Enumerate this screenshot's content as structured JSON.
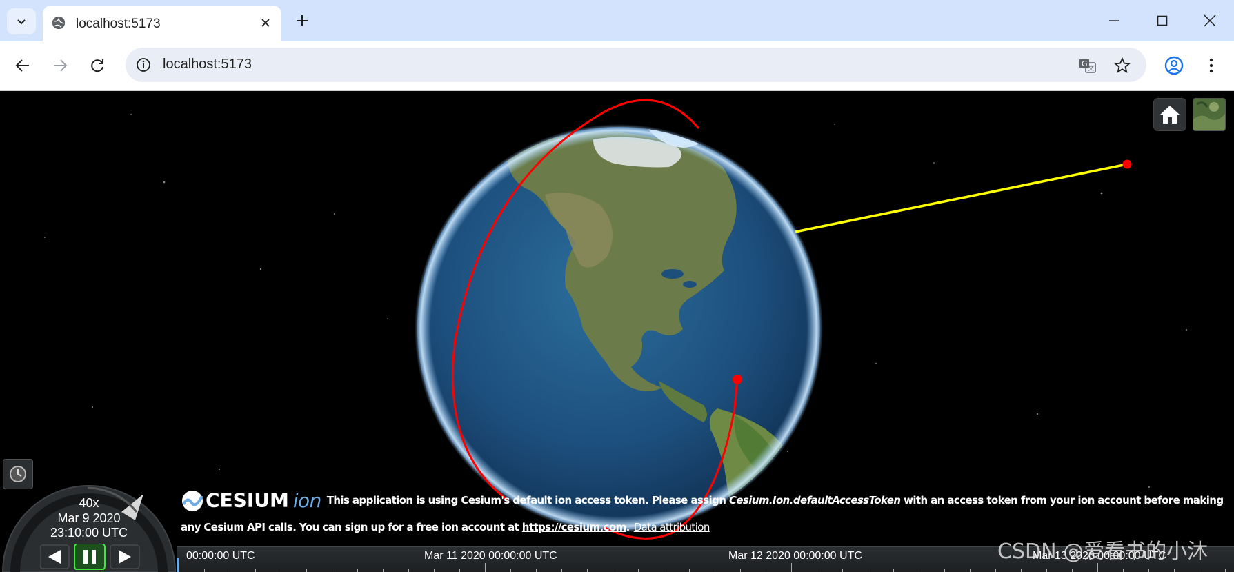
{
  "browser": {
    "tab_title": "localhost:5173",
    "url": "localhost:5173",
    "icons": [
      "tab-search-icon",
      "globe-icon",
      "close-icon",
      "plus-icon",
      "minimize-icon",
      "maximize-icon",
      "window-close-icon",
      "back-icon",
      "forward-icon",
      "reload-icon",
      "site-info-icon",
      "translate-icon",
      "bookmark-star-icon",
      "profile-icon",
      "menu-icon"
    ]
  },
  "viewer": {
    "credit": {
      "logo_text": "CESIUM",
      "logo_suffix": "ion",
      "text_1": "This application is using Cesium's default ion access token. Please assign ",
      "token_name": "Cesium.Ion.defaultAccessToken",
      "text_2": " with an access token from your ion account before making any Cesium API calls. You can sign up for a free ion account at ",
      "link": "https://cesium.com",
      "text_3": ".",
      "attribution": "Data attribution"
    },
    "animation": {
      "speed": "40x",
      "date": "Mar 9 2020",
      "time": "23:10:00 UTC",
      "state": "paused"
    },
    "timeline": {
      "labels": [
        "00:00:00 UTC",
        "Mar 11 2020 00:00:00 UTC",
        "Mar 12 2020 00:00:00 UTC",
        "Mar 13 2020 00:00:00 UTC"
      ]
    },
    "colors": {
      "orbit": "#ff0000",
      "link_line": "#ffff00",
      "point": "#ff0000",
      "timeline_bg": "#2b2e31"
    },
    "watermark": "CSDN @爱看书的小沐"
  }
}
